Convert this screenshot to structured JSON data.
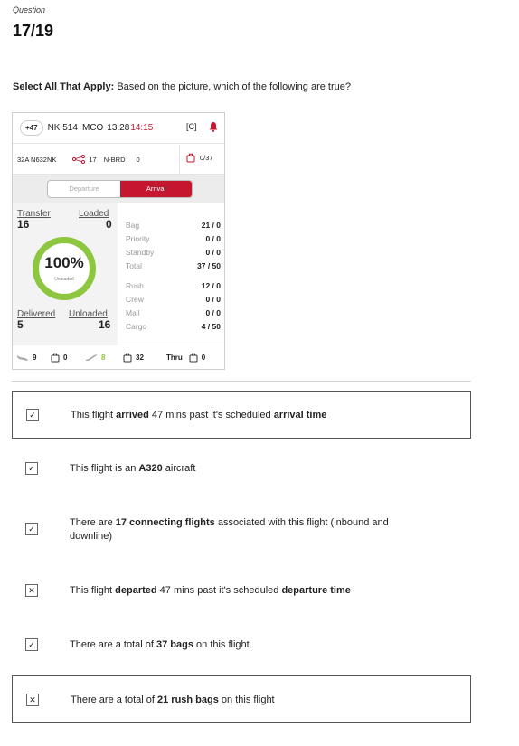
{
  "header": {
    "question_label": "Question",
    "question_number": "17/19"
  },
  "prompt": {
    "bold": "Select All That Apply:",
    "text": " Based on the picture, which of the following are true?"
  },
  "flight_card": {
    "delay_badge": "+47",
    "flight_number": "NK 514",
    "station": "MCO",
    "scheduled_time": "13:28",
    "actual_time": "14:15",
    "status_code": "[C]",
    "gate": "32A",
    "tail": "N632NK",
    "connections": "17",
    "brd_label": "N-BRD",
    "brd_value": "0",
    "bag_count": "0/37",
    "toggle_departure": "Departure",
    "toggle_arrival": "Arrival",
    "transfer_label": "Transfer",
    "transfer_value": "16",
    "loaded_label": "Loaded",
    "loaded_value": "0",
    "percent": "100%",
    "percent_sub": "Unloaded",
    "delivered_label": "Delivered",
    "delivered_value": "5",
    "unloaded_label": "Unloaded",
    "unloaded_value": "16",
    "categories": [
      {
        "label": "Bag",
        "value": "21 / 0"
      },
      {
        "label": "Priority",
        "value": "0 / 0"
      },
      {
        "label": "Standby",
        "value": "0 / 0"
      },
      {
        "label": "Total",
        "value": "37 / 50"
      },
      {
        "label": "Rush",
        "value": "12 / 0"
      },
      {
        "label": "Crew",
        "value": "0 / 0"
      },
      {
        "label": "Mail",
        "value": "0 / 0"
      },
      {
        "label": "Cargo",
        "value": "4 / 50"
      }
    ],
    "footer": {
      "plane_in": "9",
      "bag_a": "0",
      "plane_out": "8",
      "bag_b": "32",
      "thru_label": "Thru",
      "thru_value": "0"
    },
    "colors": {
      "accent": "#c4162e",
      "ring": "#8dc63f"
    }
  },
  "options": [
    {
      "mark": "✓",
      "pre": "This flight ",
      "b1": "arrived",
      "mid": " 47 mins past it's scheduled ",
      "b2": "arrival time",
      "post": ""
    },
    {
      "mark": "✓",
      "pre": "This flight is an ",
      "b1": "A320",
      "mid": " aircraft",
      "b2": "",
      "post": ""
    },
    {
      "mark": "✓",
      "pre": "There are ",
      "b1": "17 connecting flights",
      "mid": " associated with this flight (inbound and downline)",
      "b2": "",
      "post": ""
    },
    {
      "mark": "✕",
      "pre": "This flight ",
      "b1": "departed",
      "mid": " 47 mins past it's scheduled ",
      "b2": "departure time",
      "post": ""
    },
    {
      "mark": "✓",
      "pre": "There are a total of ",
      "b1": "37 bags",
      "mid": " on this flight",
      "b2": "",
      "post": ""
    },
    {
      "mark": "✕",
      "pre": "There are a total of ",
      "b1": "21 rush bags",
      "mid": " on this flight",
      "b2": "",
      "post": ""
    }
  ]
}
